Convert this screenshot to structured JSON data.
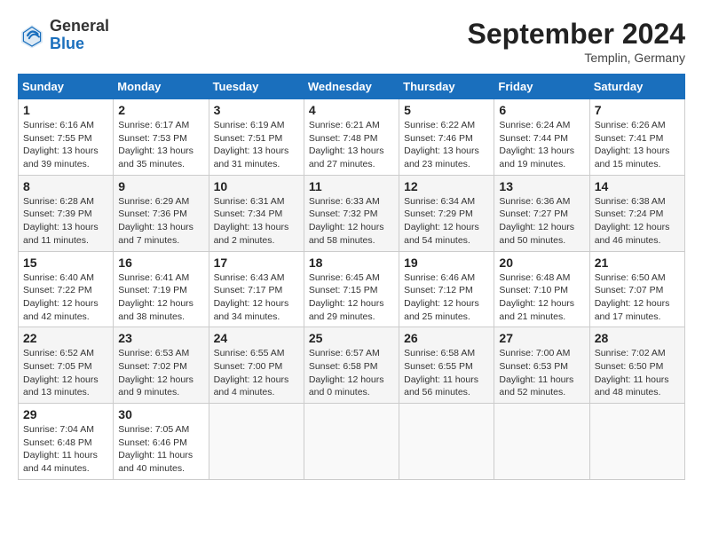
{
  "header": {
    "logo_general": "General",
    "logo_blue": "Blue",
    "month_title": "September 2024",
    "subtitle": "Templin, Germany"
  },
  "weekdays": [
    "Sunday",
    "Monday",
    "Tuesday",
    "Wednesday",
    "Thursday",
    "Friday",
    "Saturday"
  ],
  "weeks": [
    [
      {
        "day": "1",
        "info": "Sunrise: 6:16 AM\nSunset: 7:55 PM\nDaylight: 13 hours\nand 39 minutes."
      },
      {
        "day": "2",
        "info": "Sunrise: 6:17 AM\nSunset: 7:53 PM\nDaylight: 13 hours\nand 35 minutes."
      },
      {
        "day": "3",
        "info": "Sunrise: 6:19 AM\nSunset: 7:51 PM\nDaylight: 13 hours\nand 31 minutes."
      },
      {
        "day": "4",
        "info": "Sunrise: 6:21 AM\nSunset: 7:48 PM\nDaylight: 13 hours\nand 27 minutes."
      },
      {
        "day": "5",
        "info": "Sunrise: 6:22 AM\nSunset: 7:46 PM\nDaylight: 13 hours\nand 23 minutes."
      },
      {
        "day": "6",
        "info": "Sunrise: 6:24 AM\nSunset: 7:44 PM\nDaylight: 13 hours\nand 19 minutes."
      },
      {
        "day": "7",
        "info": "Sunrise: 6:26 AM\nSunset: 7:41 PM\nDaylight: 13 hours\nand 15 minutes."
      }
    ],
    [
      {
        "day": "8",
        "info": "Sunrise: 6:28 AM\nSunset: 7:39 PM\nDaylight: 13 hours\nand 11 minutes."
      },
      {
        "day": "9",
        "info": "Sunrise: 6:29 AM\nSunset: 7:36 PM\nDaylight: 13 hours\nand 7 minutes."
      },
      {
        "day": "10",
        "info": "Sunrise: 6:31 AM\nSunset: 7:34 PM\nDaylight: 13 hours\nand 2 minutes."
      },
      {
        "day": "11",
        "info": "Sunrise: 6:33 AM\nSunset: 7:32 PM\nDaylight: 12 hours\nand 58 minutes."
      },
      {
        "day": "12",
        "info": "Sunrise: 6:34 AM\nSunset: 7:29 PM\nDaylight: 12 hours\nand 54 minutes."
      },
      {
        "day": "13",
        "info": "Sunrise: 6:36 AM\nSunset: 7:27 PM\nDaylight: 12 hours\nand 50 minutes."
      },
      {
        "day": "14",
        "info": "Sunrise: 6:38 AM\nSunset: 7:24 PM\nDaylight: 12 hours\nand 46 minutes."
      }
    ],
    [
      {
        "day": "15",
        "info": "Sunrise: 6:40 AM\nSunset: 7:22 PM\nDaylight: 12 hours\nand 42 minutes."
      },
      {
        "day": "16",
        "info": "Sunrise: 6:41 AM\nSunset: 7:19 PM\nDaylight: 12 hours\nand 38 minutes."
      },
      {
        "day": "17",
        "info": "Sunrise: 6:43 AM\nSunset: 7:17 PM\nDaylight: 12 hours\nand 34 minutes."
      },
      {
        "day": "18",
        "info": "Sunrise: 6:45 AM\nSunset: 7:15 PM\nDaylight: 12 hours\nand 29 minutes."
      },
      {
        "day": "19",
        "info": "Sunrise: 6:46 AM\nSunset: 7:12 PM\nDaylight: 12 hours\nand 25 minutes."
      },
      {
        "day": "20",
        "info": "Sunrise: 6:48 AM\nSunset: 7:10 PM\nDaylight: 12 hours\nand 21 minutes."
      },
      {
        "day": "21",
        "info": "Sunrise: 6:50 AM\nSunset: 7:07 PM\nDaylight: 12 hours\nand 17 minutes."
      }
    ],
    [
      {
        "day": "22",
        "info": "Sunrise: 6:52 AM\nSunset: 7:05 PM\nDaylight: 12 hours\nand 13 minutes."
      },
      {
        "day": "23",
        "info": "Sunrise: 6:53 AM\nSunset: 7:02 PM\nDaylight: 12 hours\nand 9 minutes."
      },
      {
        "day": "24",
        "info": "Sunrise: 6:55 AM\nSunset: 7:00 PM\nDaylight: 12 hours\nand 4 minutes."
      },
      {
        "day": "25",
        "info": "Sunrise: 6:57 AM\nSunset: 6:58 PM\nDaylight: 12 hours\nand 0 minutes."
      },
      {
        "day": "26",
        "info": "Sunrise: 6:58 AM\nSunset: 6:55 PM\nDaylight: 11 hours\nand 56 minutes."
      },
      {
        "day": "27",
        "info": "Sunrise: 7:00 AM\nSunset: 6:53 PM\nDaylight: 11 hours\nand 52 minutes."
      },
      {
        "day": "28",
        "info": "Sunrise: 7:02 AM\nSunset: 6:50 PM\nDaylight: 11 hours\nand 48 minutes."
      }
    ],
    [
      {
        "day": "29",
        "info": "Sunrise: 7:04 AM\nSunset: 6:48 PM\nDaylight: 11 hours\nand 44 minutes."
      },
      {
        "day": "30",
        "info": "Sunrise: 7:05 AM\nSunset: 6:46 PM\nDaylight: 11 hours\nand 40 minutes."
      },
      {
        "day": "",
        "info": ""
      },
      {
        "day": "",
        "info": ""
      },
      {
        "day": "",
        "info": ""
      },
      {
        "day": "",
        "info": ""
      },
      {
        "day": "",
        "info": ""
      }
    ]
  ]
}
